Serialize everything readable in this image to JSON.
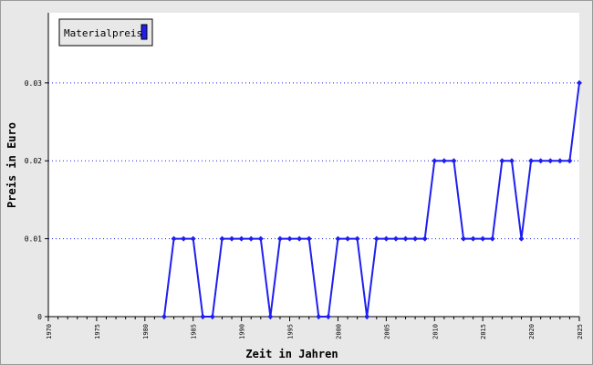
{
  "chart_data": {
    "type": "line",
    "title": "",
    "xlabel": "Zeit in Jahren",
    "ylabel": "Preis in Euro",
    "xlim": [
      1970,
      2025
    ],
    "ylim": [
      0,
      0.039
    ],
    "x_ticks": [
      "1970",
      "1975",
      "1980",
      "1985",
      "1990",
      "1995",
      "2000",
      "2005",
      "2010",
      "2015",
      "2020",
      "2025"
    ],
    "y_ticks": [
      "0",
      "0.01",
      "0.02",
      "0.03"
    ],
    "grid": "horizontal-dotted",
    "legend": "top-left",
    "series": [
      {
        "name": "Materialpreis",
        "color": "#1f1ff0",
        "x": [
          1982,
          1983,
          1984,
          1985,
          1986,
          1987,
          1988,
          1989,
          1990,
          1991,
          1992,
          1993,
          1994,
          1995,
          1996,
          1997,
          1998,
          1999,
          2000,
          2001,
          2002,
          2003,
          2004,
          2005,
          2006,
          2007,
          2008,
          2009,
          2010,
          2011,
          2012,
          2013,
          2014,
          2015,
          2016,
          2017,
          2018,
          2019,
          2020,
          2021,
          2022,
          2023,
          2024,
          2025
        ],
        "values": [
          0,
          0.01,
          0.01,
          0.01,
          0,
          0,
          0.01,
          0.01,
          0.01,
          0.01,
          0.01,
          0,
          0.01,
          0.01,
          0.01,
          0.01,
          0,
          0,
          0.01,
          0.01,
          0.01,
          0,
          0.01,
          0.01,
          0.01,
          0.01,
          0.01,
          0.01,
          0.02,
          0.02,
          0.02,
          0.01,
          0.01,
          0.01,
          0.01,
          0.02,
          0.02,
          0.01,
          0.02,
          0.02,
          0.02,
          0.02,
          0.02,
          0.03
        ]
      }
    ]
  }
}
